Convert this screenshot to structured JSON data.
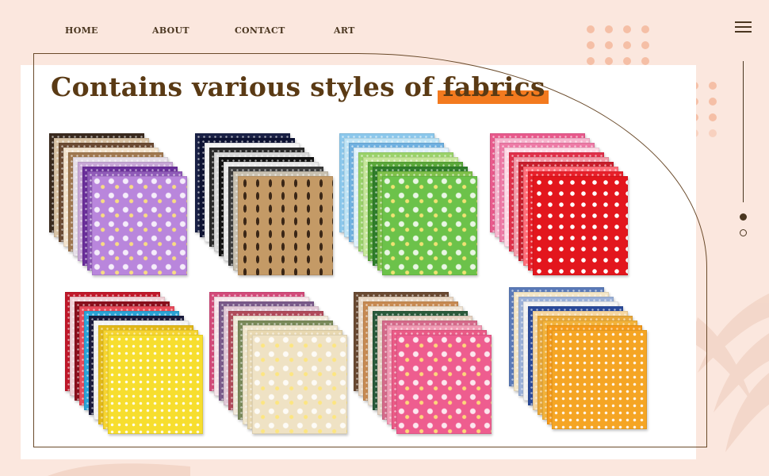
{
  "nav": {
    "items": [
      "HOME",
      "ABOUT",
      "CONTACT",
      "ART"
    ]
  },
  "menu_icon": "hamburger-menu-icon",
  "headline": {
    "prefix": "Contains various styles of",
    "highlight": "fabrics"
  },
  "pager": {
    "count": 2,
    "active_index": 0
  },
  "colors": {
    "background": "#fbe7de",
    "accent_text": "#5a3a14",
    "highlight": "#f37a1f",
    "dots": "#f5bfa6"
  },
  "fabric_stacks": [
    {
      "name": "purple-floral",
      "colors": [
        "#3a2a1e",
        "#d8c2a4",
        "#6b4a32",
        "#f2e2cc",
        "#a07850",
        "#e6dfe8",
        "#c7a6d6",
        "#6a2e9a",
        "#8f5ab8"
      ],
      "front": "#b986dc",
      "pattern": "floral"
    },
    {
      "name": "navy-polka",
      "colors": [
        "#1a2146",
        "#0d1233",
        "#f3f3f3",
        "#2a2a2a",
        "#d8d8d8",
        "#111111",
        "#e8e8e8",
        "#3a3a3a",
        "#c8c0b0"
      ],
      "front": "#c49a66",
      "pattern": "leaf"
    },
    {
      "name": "green-blue",
      "colors": [
        "#8cc8ec",
        "#bfe4f6",
        "#6fb0e0",
        "#dff1fb",
        "#9ad26a",
        "#c6e79a",
        "#5aa83a",
        "#2f7d2a",
        "#7fc04a"
      ],
      "front": "#6cc24a",
      "pattern": "floral"
    },
    {
      "name": "red-pink",
      "colors": [
        "#e85a8c",
        "#f7b6cf",
        "#ee7aa6",
        "#ffd9e6",
        "#e0304a",
        "#f49aa8",
        "#c81e2c",
        "#ff6f7a",
        "#e8202a"
      ],
      "front": "#e3161d",
      "pattern": "star"
    },
    {
      "name": "yellow-mix",
      "colors": [
        "#c0182a",
        "#f1d0d6",
        "#8a0f1c",
        "#e84a5a",
        "#2aa3d6",
        "#1a1a3c",
        "#f2f2f2",
        "#e2b818",
        "#f6d430"
      ],
      "front": "#f7de2e",
      "pattern": "dot"
    },
    {
      "name": "ditsy-floral",
      "colors": [
        "#d34a7a",
        "#f7e4ea",
        "#7a5a8a",
        "#e1c8d6",
        "#b04a5a",
        "#f1e8d8",
        "#7a8a5a",
        "#f0e6cc",
        "#e8d8b0"
      ],
      "front": "#efe2c4",
      "pattern": "floral"
    },
    {
      "name": "pink-daisy",
      "colors": [
        "#6a4a32",
        "#e9d7c4",
        "#c78a52",
        "#f0e4d4",
        "#2a5a3a",
        "#e6d2c2",
        "#d46a8a",
        "#f29ab4",
        "#ea5a86"
      ],
      "front": "#ee5d8f",
      "pattern": "floral"
    },
    {
      "name": "orange-blue",
      "colors": [
        "#5a7ab8",
        "#f4e6c6",
        "#9ab0d8",
        "#f2f2f2",
        "#2a4a9a",
        "#f6d6a0",
        "#e8a83a",
        "#f2b23a",
        "#f59a1a"
      ],
      "front": "#f5a524",
      "pattern": "dot"
    }
  ]
}
